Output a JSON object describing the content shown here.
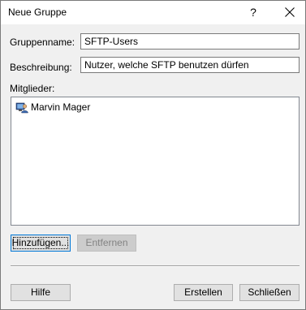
{
  "window": {
    "title": "Neue Gruppe",
    "help_symbol": "?"
  },
  "form": {
    "name_label": "Gruppenname:",
    "name_value": "SFTP-Users",
    "description_label": "Beschreibung:",
    "description_value": "Nutzer, welche SFTP benutzen dürfen",
    "members_label": "Mitglieder:"
  },
  "members": [
    {
      "name": "Marvin Mager",
      "icon": "user-icon"
    }
  ],
  "buttons": {
    "add": "Hinzufügen...",
    "remove": "Entfernen",
    "help": "Hilfe",
    "create": "Erstellen",
    "close": "Schließen"
  }
}
